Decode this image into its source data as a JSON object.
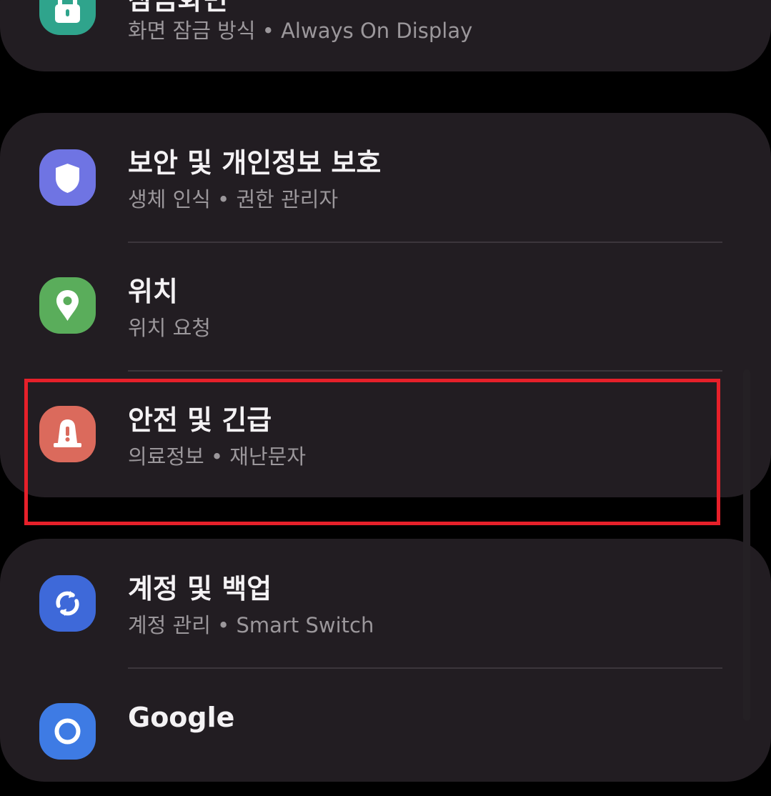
{
  "items": [
    {
      "id": "lock-screen",
      "title": "잠금화면",
      "subtitle_parts": [
        "화면 잠금 방식",
        "Always On Display"
      ],
      "icon": "lock-icon",
      "color": "#2fa48c"
    },
    {
      "id": "security-privacy",
      "title": "보안 및 개인정보 보호",
      "subtitle_parts": [
        "생체 인식",
        "권한 관리자"
      ],
      "icon": "shield-icon",
      "color": "#6f74e3"
    },
    {
      "id": "location",
      "title": "위치",
      "subtitle_parts": [
        "위치 요청"
      ],
      "icon": "location-pin-icon",
      "color": "#5aad5b"
    },
    {
      "id": "safety-emergency",
      "title": "안전 및 긴급",
      "subtitle_parts": [
        "의료정보",
        "재난문자"
      ],
      "icon": "siren-icon",
      "color": "#db6a5c"
    },
    {
      "id": "accounts-backup",
      "title": "계정 및 백업",
      "subtitle_parts": [
        "계정 관리",
        "Smart Switch"
      ],
      "icon": "sync-icon",
      "color": "#3e69d9"
    },
    {
      "id": "google",
      "title": "Google",
      "subtitle_parts": [],
      "icon": "google-icon",
      "color": "#3e7be4"
    }
  ],
  "separator": " • ",
  "colors": {
    "background": "#000000",
    "card": "#221d22",
    "title": "#f4f2f4",
    "subtitle": "#9b979b",
    "highlight": "#e6202a"
  }
}
